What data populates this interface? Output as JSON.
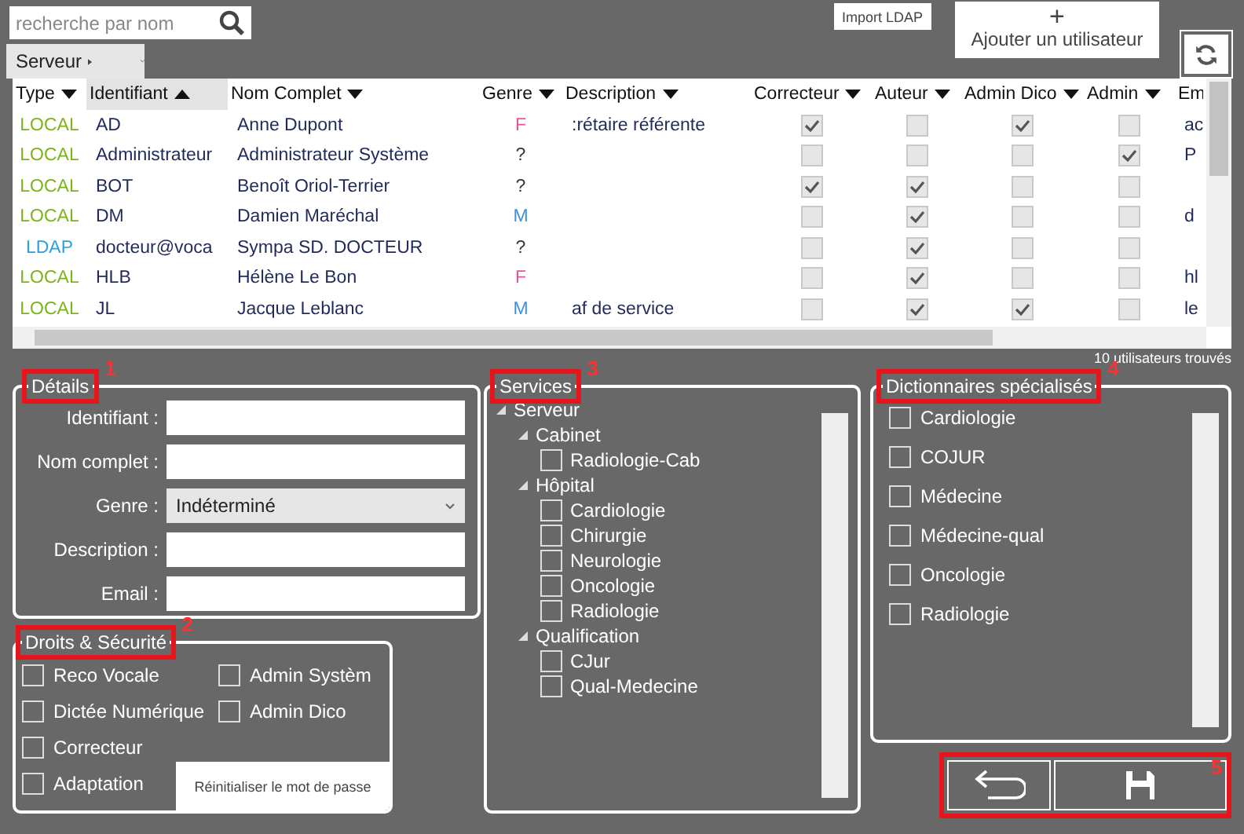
{
  "search": {
    "placeholder": "recherche par nom"
  },
  "import_button": "Import LDAP",
  "add_button": {
    "icon": "+",
    "label": "Ajouter un utilisateur"
  },
  "breadcrumb": {
    "label": "Serveur"
  },
  "table": {
    "columns": [
      {
        "label": "Type",
        "sorted": false
      },
      {
        "label": "Identifiant",
        "sorted": true
      },
      {
        "label": "Nom Complet",
        "sorted": false
      },
      {
        "label": "Genre",
        "sorted": false
      },
      {
        "label": "Description",
        "sorted": false
      },
      {
        "label": "Correcteur",
        "sorted": false
      },
      {
        "label": "Auteur",
        "sorted": false
      },
      {
        "label": "Admin Dico",
        "sorted": false
      },
      {
        "label": "Admin",
        "sorted": false
      },
      {
        "label": "Em"
      }
    ],
    "rows": [
      {
        "type": {
          "text": "LOCAL",
          "color": "#7cb518"
        },
        "id": "AD",
        "name": "Anne Dupont",
        "genre": {
          "text": "F",
          "color": "#e8559a"
        },
        "description": ":rétaire référente",
        "correcteur": true,
        "auteur": false,
        "admin_dico": true,
        "admin": false,
        "email": "ac"
      },
      {
        "type": {
          "text": "LOCAL",
          "color": "#7cb518"
        },
        "id": "Administrateur",
        "name": "Administrateur Système",
        "genre": {
          "text": "?",
          "color": "#333333"
        },
        "description": "",
        "correcteur": false,
        "auteur": false,
        "admin_dico": false,
        "admin": true,
        "email": "P"
      },
      {
        "type": {
          "text": "LOCAL",
          "color": "#7cb518"
        },
        "id": "BOT",
        "name": "Benoît Oriol-Terrier",
        "genre": {
          "text": "?",
          "color": "#333333"
        },
        "description": "",
        "correcteur": true,
        "auteur": true,
        "admin_dico": false,
        "admin": false,
        "email": ""
      },
      {
        "type": {
          "text": "LOCAL",
          "color": "#7cb518"
        },
        "id": "DM",
        "name": "Damien Maréchal",
        "genre": {
          "text": "M",
          "color": "#3d8fe0"
        },
        "description": "",
        "correcteur": false,
        "auteur": true,
        "admin_dico": false,
        "admin": false,
        "email": "d"
      },
      {
        "type": {
          "text": "LDAP",
          "color": "#2aa0dc"
        },
        "id": "docteur@voca",
        "name": "Sympa SD. DOCTEUR",
        "genre": {
          "text": "?",
          "color": "#333333"
        },
        "description": "",
        "correcteur": false,
        "auteur": true,
        "admin_dico": false,
        "admin": false,
        "email": ""
      },
      {
        "type": {
          "text": "LOCAL",
          "color": "#7cb518"
        },
        "id": "HLB",
        "name": "Hélène Le Bon",
        "genre": {
          "text": "F",
          "color": "#e8559a"
        },
        "description": "",
        "correcteur": false,
        "auteur": true,
        "admin_dico": false,
        "admin": false,
        "email": "hl"
      },
      {
        "type": {
          "text": "LOCAL",
          "color": "#7cb518"
        },
        "id": "JL",
        "name": "Jacque Leblanc",
        "genre": {
          "text": "M",
          "color": "#3d8fe0"
        },
        "description": "af de service",
        "correcteur": false,
        "auteur": true,
        "admin_dico": true,
        "admin": false,
        "email": "le"
      }
    ]
  },
  "status": "10 utilisateurs trouvés",
  "details": {
    "title": "Détails",
    "marker": "1",
    "fields": [
      {
        "label": "Identifiant :",
        "kind": "text"
      },
      {
        "label": "Nom complet :",
        "kind": "text"
      },
      {
        "label": "Genre :",
        "kind": "select",
        "value": "Indéterminé"
      },
      {
        "label": "Description :",
        "kind": "text"
      },
      {
        "label": "Email :",
        "kind": "text"
      }
    ]
  },
  "rights": {
    "title": "Droits & Sécurité",
    "marker": "2",
    "options": [
      {
        "label": "Reco Vocale",
        "checked": false
      },
      {
        "label": "Dictée Numérique",
        "checked": false
      },
      {
        "label": "Correcteur",
        "checked": false
      },
      {
        "label": "Adaptation",
        "checked": false
      },
      {
        "label": "Admin Systèm",
        "checked": false
      },
      {
        "label": "Admin Dico",
        "checked": false
      }
    ],
    "reset_button": "Réinitialiser le mot de passe"
  },
  "services": {
    "title": "Services",
    "marker": "3",
    "tree": [
      {
        "label": "Serveur",
        "expanded": true,
        "children": [
          {
            "label": "Cabinet",
            "expanded": true,
            "children": [
              {
                "label": "Radiologie-Cab",
                "checked": false
              }
            ]
          },
          {
            "label": "Hôpital",
            "expanded": true,
            "children": [
              {
                "label": "Cardiologie",
                "checked": false
              },
              {
                "label": "Chirurgie",
                "checked": false
              },
              {
                "label": "Neurologie",
                "checked": false
              },
              {
                "label": "Oncologie",
                "checked": false
              },
              {
                "label": "Radiologie",
                "checked": false
              }
            ]
          },
          {
            "label": "Qualification",
            "expanded": true,
            "children": [
              {
                "label": "CJur",
                "checked": false
              },
              {
                "label": "Qual-Medecine",
                "checked": false
              }
            ]
          }
        ]
      }
    ]
  },
  "dictionaries": {
    "title": "Dictionnaires spécialisés",
    "marker": "4",
    "items": [
      {
        "label": "Cardiologie",
        "checked": false
      },
      {
        "label": "COJUR",
        "checked": false
      },
      {
        "label": "Médecine",
        "checked": false
      },
      {
        "label": "Médecine-qual",
        "checked": false
      },
      {
        "label": "Oncologie",
        "checked": false
      },
      {
        "label": "Radiologie",
        "checked": false
      }
    ]
  },
  "actions": {
    "marker": "5"
  }
}
